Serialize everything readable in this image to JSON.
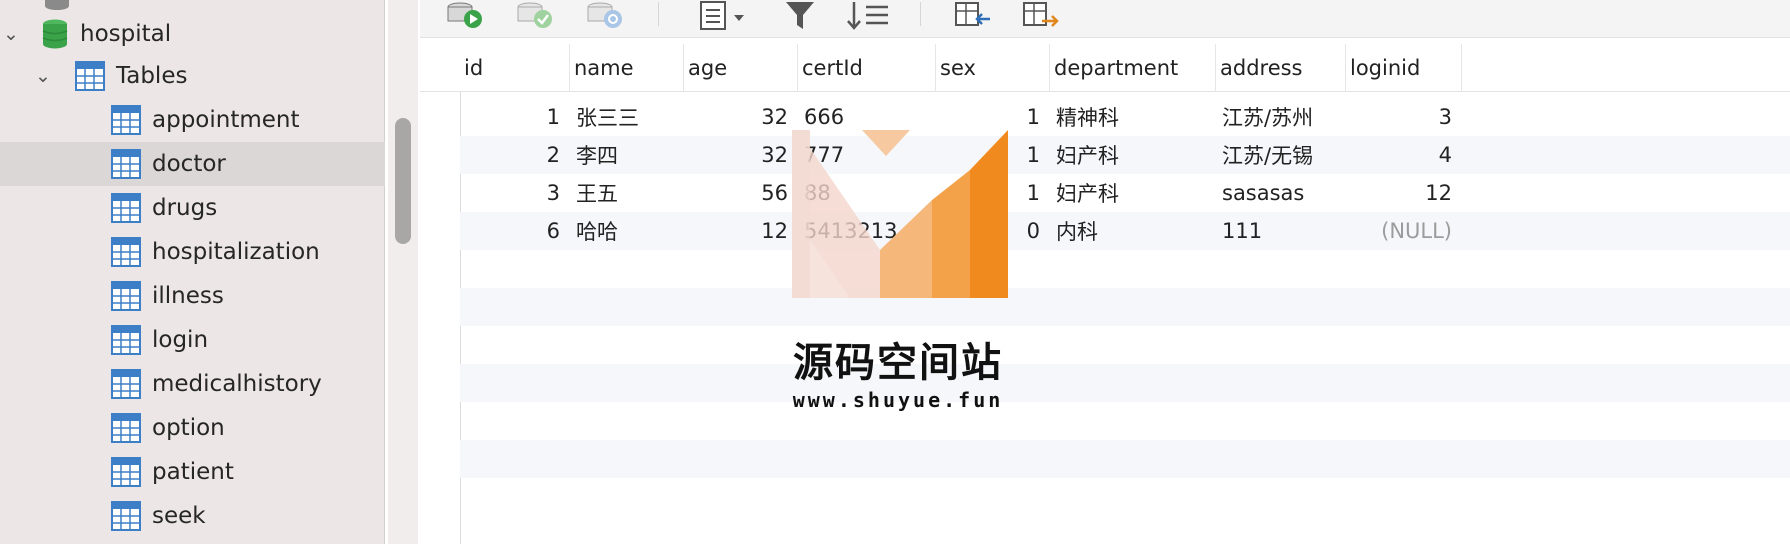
{
  "sidebar": {
    "database": "hospital",
    "tables_folder": "Tables",
    "tables": [
      "appointment",
      "doctor",
      "drugs",
      "hospitalization",
      "illness",
      "login",
      "medicalhistory",
      "option",
      "patient",
      "seek"
    ],
    "selected_table": "doctor"
  },
  "toolbar": {
    "icons": [
      "add-row-icon",
      "commit-icon",
      "refresh-icon",
      "text-view-icon",
      "filter-icon",
      "sort-icon",
      "import-icon",
      "export-icon"
    ]
  },
  "grid": {
    "columns": [
      "id",
      "name",
      "age",
      "certId",
      "sex",
      "department",
      "address",
      "loginid"
    ],
    "rows": [
      {
        "id": "1",
        "name": "张三三",
        "age": "32",
        "certId": "666",
        "sex": "1",
        "department": "精神科",
        "address": "江苏/苏州",
        "loginid": "3"
      },
      {
        "id": "2",
        "name": "李四",
        "age": "32",
        "certId": "777",
        "sex": "1",
        "department": "妇产科",
        "address": "江苏/无锡",
        "loginid": "4"
      },
      {
        "id": "3",
        "name": "王五",
        "age": "56",
        "certId": "88",
        "sex": "1",
        "department": "妇产科",
        "address": "sasasas",
        "loginid": "12"
      },
      {
        "id": "6",
        "name": "哈哈",
        "age": "12",
        "certId": "5413213",
        "sex": "0",
        "department": "内科",
        "address": "111",
        "loginid": "(NULL)"
      }
    ]
  },
  "watermark": {
    "title": "源码空间站",
    "url": "www.shuyue.fun"
  },
  "colors": {
    "sidebar_bg": "#ece6e6",
    "db_icon": "#3aa34a",
    "table_icon": "#3d7fc7",
    "watermark_orange": "#f08a1e"
  }
}
